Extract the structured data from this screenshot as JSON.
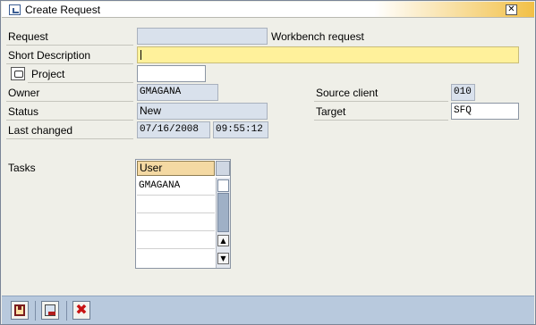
{
  "window": {
    "title": "Create Request",
    "close_glyph": "✕"
  },
  "form": {
    "request_label": "Request",
    "request_value": "",
    "request_type": "Workbench request",
    "short_description_label": "Short Description",
    "short_description_value": "",
    "project_label": "Project",
    "project_value": "",
    "owner_label": "Owner",
    "owner_value": "GMAGANA",
    "status_label": "Status",
    "status_value": "New",
    "last_changed_label": "Last changed",
    "last_changed_date": "07/16/2008",
    "last_changed_time": "09:55:12",
    "source_client_label": "Source client",
    "source_client_value": "010",
    "target_label": "Target",
    "target_value": "SFQ"
  },
  "tasks": {
    "label": "Tasks",
    "column_header": "User",
    "rows": [
      "GMAGANA",
      "",
      "",
      "",
      ""
    ]
  },
  "toolbar": {
    "buttons": [
      {
        "name": "save-icon"
      },
      {
        "name": "local-request-icon"
      },
      {
        "name": "cancel-icon",
        "glyph": "✖"
      }
    ]
  },
  "colors": {
    "readonly_field": "#d9e1ec",
    "required_field": "#fff19b",
    "toolbar_bg": "#b8c9dd",
    "title_gradient_end": "#f2c046",
    "column_header": "#f4d9a3"
  }
}
